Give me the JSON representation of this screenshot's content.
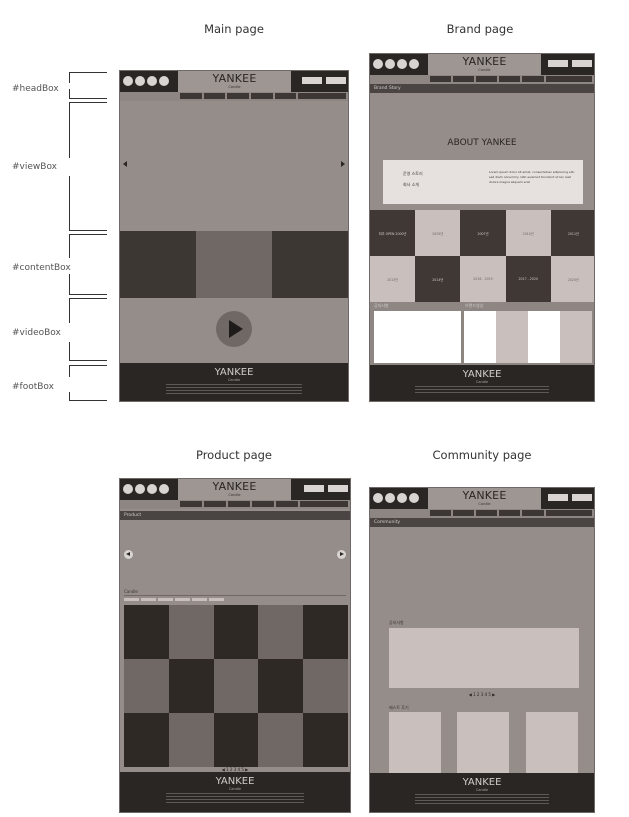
{
  "page_titles": {
    "main": "Main page",
    "brand": "Brand page",
    "product": "Product page",
    "community": "Community page"
  },
  "annotations": [
    "#headBox",
    "#viewBox",
    "#contentBox",
    "#videoBox",
    "#footBox"
  ],
  "header": {
    "logo": "YANKEE",
    "logo_sub": "Candle"
  },
  "footer": {
    "logo": "YANKEE",
    "logo_sub": "Candle"
  },
  "brand": {
    "section_label": "Brand Story",
    "about_title": "ABOUT YANKEE",
    "about_left": [
      "운영 스토리",
      "회사 소개"
    ],
    "about_text": "Lorem ipsum dolor sit amet, consectetuer adipiscing elit, sed diam nonummy nibh euismod tincidunt ut lao reet dolore magna aliquam erat",
    "history": [
      {
        "row1": "최초 OPEN 2000년"
      },
      {
        "row1": "2005년"
      },
      {
        "row1": "2007년"
      },
      {
        "row1": "2010년"
      },
      {
        "row1": "2011년"
      }
    ],
    "history_row2": [
      "2013년",
      "2014년",
      "2016 - 2019",
      "2017 - 2020",
      "2020년"
    ],
    "bottom_labels": [
      "공지사항",
      "브랜드영상"
    ]
  },
  "product": {
    "section_label": "Product",
    "category_label": "Candle",
    "pagination": "◀ 1 2 3 4 5 ▶"
  },
  "community": {
    "section_label": "Community",
    "label1": "공지사항",
    "pagination": "◀ 1 2 3 4 5 ▶",
    "label2": "베스트 후기"
  }
}
